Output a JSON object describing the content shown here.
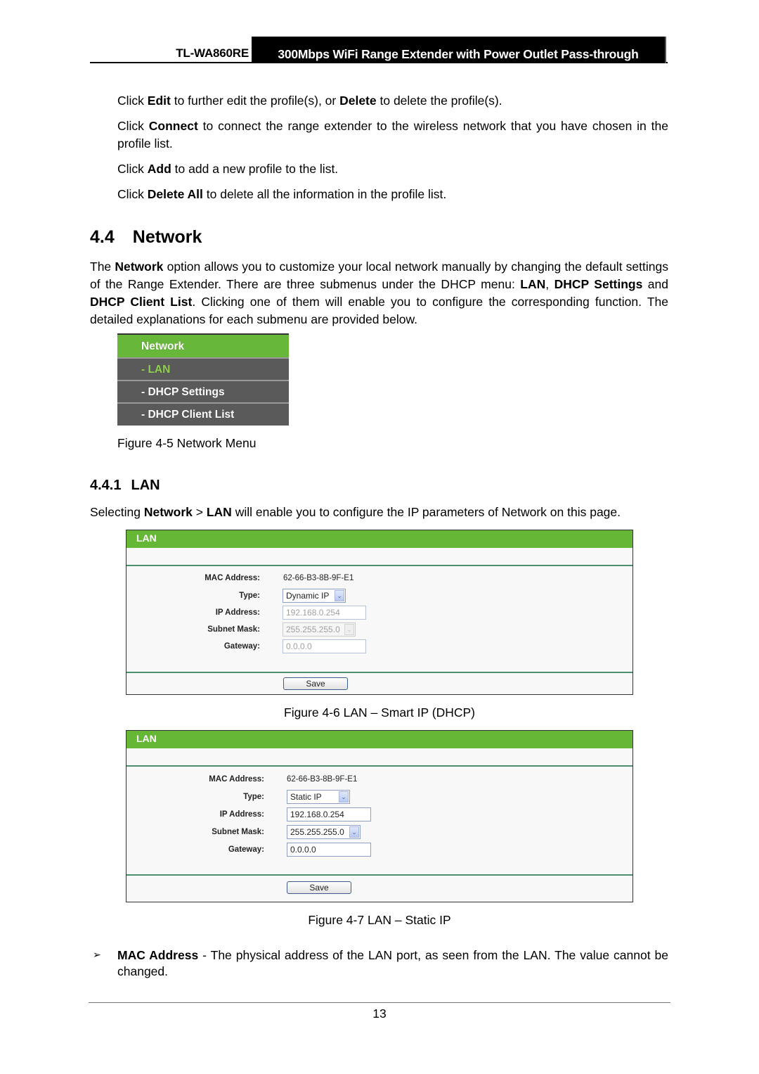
{
  "header": {
    "model": "TL-WA860RE",
    "title": "300Mbps WiFi Range Extender with Power Outlet Pass-through"
  },
  "intro": [
    {
      "pre": "Click ",
      "b1": "Edit",
      "mid": " to further edit the profile(s), or ",
      "b2": "Delete",
      "post": " to delete the profile(s)."
    },
    {
      "pre": "Click ",
      "b1": "Connect",
      "post": " to connect the range extender to the wireless network that you have chosen in the profile list."
    },
    {
      "pre": "Click ",
      "b1": "Add",
      "post": " to add a new profile to the list."
    },
    {
      "pre": "Click ",
      "b1": "Delete All",
      "post": " to delete all the information in the profile list."
    }
  ],
  "section": {
    "number": "4.4",
    "title": "Network",
    "para": {
      "t1": "The ",
      "b1": "Network",
      "t2": " option allows you to customize your local network manually by changing the default settings of the Range Extender. There are three submenus under the DHCP menu: ",
      "b2": "LAN",
      "t3": ", ",
      "b3": "DHCP Settings",
      "t4": " and ",
      "b4": "DHCP Client List",
      "t5": ". Clicking one of them will enable you to configure the corresponding function. The detailed explanations for each submenu are provided below."
    }
  },
  "network_menu": {
    "items": [
      "Network",
      "- LAN",
      "- DHCP Settings",
      "- DHCP Client List"
    ],
    "caption": "Figure 4-5 Network Menu"
  },
  "subsection": {
    "number": "4.4.1",
    "title": "LAN",
    "para": {
      "t1": "Selecting ",
      "b1": "Network",
      "t2": " > ",
      "b2": "LAN",
      "t3": " will enable you to configure the IP parameters of Network on this page."
    }
  },
  "figure_dhcp": {
    "panel_title": "LAN",
    "labels": {
      "mac": "MAC Address:",
      "type": "Type:",
      "ip": "IP Address:",
      "mask": "Subnet Mask:",
      "gateway": "Gateway:"
    },
    "mac_value": "62-66-B3-8B-9F-E1",
    "type_value": "Dynamic IP",
    "ip_value": "192.168.0.254",
    "mask_value": "255.255.255.0",
    "gateway_value": "0.0.0.0",
    "save_label": "Save",
    "caption": "Figure 4-6 LAN – Smart IP (DHCP)"
  },
  "figure_static": {
    "panel_title": "LAN",
    "labels": {
      "mac": "MAC Address:",
      "type": "Type:",
      "ip": "IP Address:",
      "mask": "Subnet Mask:",
      "gateway": "Gateway:"
    },
    "mac_value": "62-66-B3-8B-9F-E1",
    "type_value": "Static IP",
    "ip_value": "192.168.0.254",
    "mask_value": "255.255.255.0",
    "gateway_value": "0.0.0.0",
    "save_label": "Save",
    "caption": "Figure 4-7 LAN – Static IP"
  },
  "bullets": [
    {
      "icon": "arrow-bullet-icon",
      "term": "MAC Address",
      "text": " - The physical address of the LAN port, as seen from the LAN. The value cannot be changed."
    }
  ],
  "page_number": "13",
  "colors": {
    "menu_green": "#67b73a",
    "menu_gray": "#5a5a5a",
    "active_item": "#8fd14f",
    "panel_header": "#66b735",
    "divider": "#4e8f72"
  }
}
